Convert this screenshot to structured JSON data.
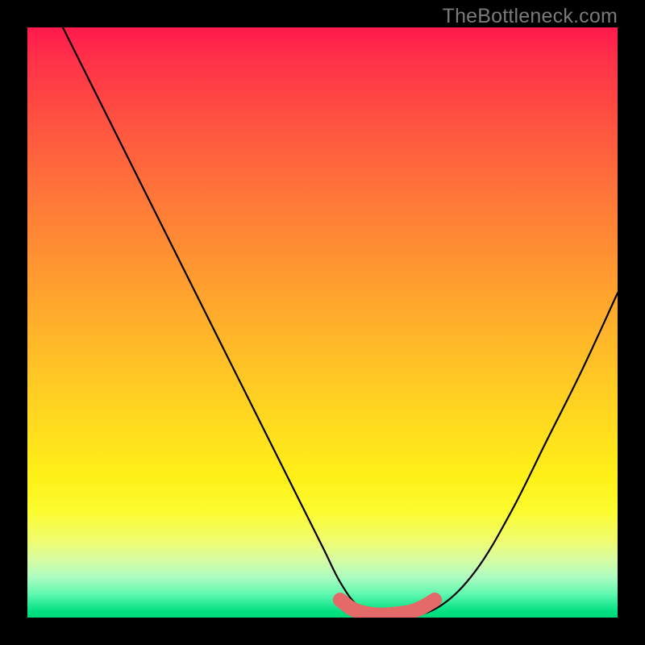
{
  "attribution": "TheBottleneck.com",
  "chart_data": {
    "type": "line",
    "title": "",
    "xlabel": "",
    "ylabel": "",
    "xlim": [
      0,
      100
    ],
    "ylim": [
      0,
      100
    ],
    "background_gradient": "heatmap red→yellow→green (top→bottom)",
    "series": [
      {
        "name": "main-curve",
        "color": "#000000",
        "x": [
          6,
          10,
          15,
          20,
          25,
          30,
          35,
          40,
          45,
          50,
          53,
          56,
          60,
          64,
          70,
          76,
          82,
          88,
          94,
          100
        ],
        "y": [
          100,
          92,
          82,
          72,
          62,
          52,
          42,
          32,
          22,
          12,
          6,
          2,
          0,
          0,
          2,
          8,
          18,
          30,
          42,
          55
        ]
      },
      {
        "name": "highlight-marker",
        "color": "#e86b6b",
        "x": [
          53,
          55,
          57,
          59,
          61,
          63,
          65,
          67,
          69
        ],
        "y": [
          3,
          1.5,
          0.8,
          0.5,
          0.5,
          0.7,
          1,
          1.8,
          3
        ]
      }
    ]
  }
}
